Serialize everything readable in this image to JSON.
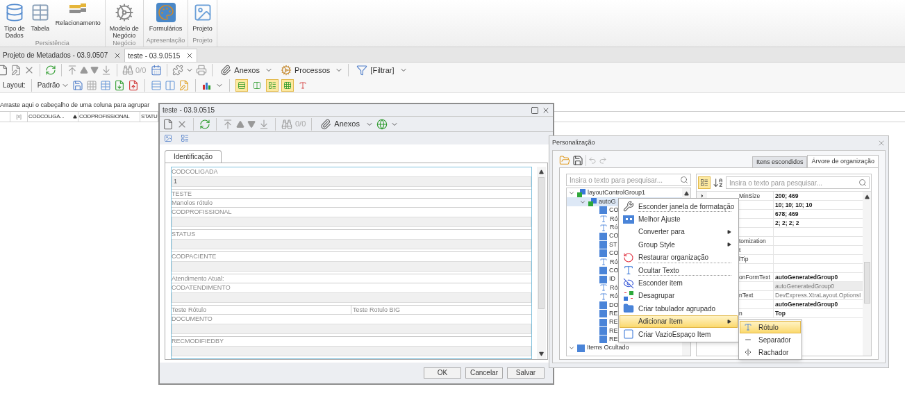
{
  "ribbon": {
    "groups": [
      {
        "label": "Persistência",
        "items": [
          {
            "label": "Tipo de\nDados"
          },
          {
            "label": "Tabela"
          },
          {
            "label": "Relacionamento"
          }
        ]
      },
      {
        "label": "Negócio",
        "items": [
          {
            "label": "Modelo de\nNegócio"
          }
        ]
      },
      {
        "label": "Apresentação",
        "items": [
          {
            "label": "Formulários"
          }
        ]
      },
      {
        "label": "Projeto",
        "items": [
          {
            "label": "Projeto"
          }
        ]
      }
    ]
  },
  "doc_tabs": [
    {
      "label": "Projeto de Metadados - 03.9.0507",
      "selected": false
    },
    {
      "label": "teste - 03.9.0515",
      "selected": true
    }
  ],
  "toolbar": {
    "counter": "0/0",
    "attachments": "Anexos",
    "processes": "Processos",
    "filter": "[Filtrar]"
  },
  "layout_bar": {
    "label": "Layout:",
    "preset": "Padrão",
    "toggles": [
      {
        "selected": true
      },
      {
        "selected": false
      },
      {
        "selected": true
      },
      {
        "selected": true
      },
      {
        "selected": false
      }
    ]
  },
  "group_panel": "Arraste aqui o cabeçalho de uma coluna para agrupar",
  "grid_columns": [
    "[x]",
    "CODCOLIGA...",
    "CODPROFISSIONAL",
    "STATU"
  ],
  "dialog": {
    "title": "teste - 03.9.0515",
    "counter": "0/0",
    "attachments": "Anexos",
    "tabs": [
      {
        "label": "Identificação",
        "selected": true
      }
    ],
    "form": [
      {
        "kind": "field",
        "label": "CODCOLIGADA",
        "value": "1"
      },
      {
        "kind": "label",
        "label": "TESTE"
      },
      {
        "kind": "label",
        "label": "Manolos rótulo"
      },
      {
        "kind": "field",
        "label": "CODPROFISSIONAL"
      },
      {
        "kind": "field",
        "label": "STATUS"
      },
      {
        "kind": "field",
        "label": "CODPACIENTE"
      },
      {
        "kind": "label",
        "label": "Atendimento Atual:"
      },
      {
        "kind": "field",
        "label": "CODATENDIMENTO"
      },
      {
        "kind": "pair",
        "label": "Teste Rótulo",
        "label_2": "Teste Rotulo BIG"
      },
      {
        "kind": "field",
        "label": "DOCUMENTO"
      },
      {
        "kind": "field",
        "label": "RECMODIFIEDBY"
      }
    ],
    "buttons": [
      "OK",
      "Cancelar",
      "Salvar"
    ]
  },
  "customization": {
    "title": "Personalização",
    "tabs": [
      {
        "label": "Itens escondidos",
        "selected": false
      },
      {
        "label": "Árvore de organização",
        "selected": true
      }
    ],
    "tree_search": {
      "placeholder": "Insira o texto para pesquisar..."
    },
    "tree": [
      {
        "label": "layoutControlGroup1",
        "kind": "group",
        "expanded": true,
        "children": [
          {
            "label": "autoG",
            "kind": "group",
            "expanded": true,
            "selected": true,
            "children": [
              {
                "label": "CO",
                "kind": "field"
              },
              {
                "label": "Ró",
                "kind": "label"
              },
              {
                "label": "Ró",
                "kind": "label"
              },
              {
                "label": "CO",
                "kind": "field"
              },
              {
                "label": "ST",
                "kind": "field"
              },
              {
                "label": "CO",
                "kind": "field"
              },
              {
                "label": "Ró",
                "kind": "label"
              },
              {
                "label": "CO",
                "kind": "field"
              },
              {
                "label": "ID",
                "kind": "field"
              },
              {
                "label": "Ró",
                "kind": "label"
              },
              {
                "label": "Ró",
                "kind": "label"
              },
              {
                "label": "DO",
                "kind": "field"
              },
              {
                "label": "RE",
                "kind": "field"
              },
              {
                "label": "RE",
                "kind": "field"
              },
              {
                "label": "RE",
                "kind": "field"
              },
              {
                "label": "RE",
                "kind": "field"
              }
            ]
          }
        ]
      },
      {
        "label": "Items Ocultado",
        "kind": "field",
        "expanded": true
      }
    ],
    "property_search": {
      "placeholder": "Insira o texto para pesquisar..."
    },
    "properties": [
      {
        "name": "MinSize",
        "value": "200; 469",
        "bold": true,
        "expandable": true,
        "selected": false
      },
      {
        "value": "10; 10; 10; 10",
        "bold": true,
        "selected": false
      },
      {
        "value": "678; 469",
        "bold": true,
        "selected": false
      },
      {
        "value": "2; 2; 2; 2",
        "bold": true,
        "selected": false
      },
      {
        "selected": false
      },
      {
        "name": "tomization",
        "selected": false
      },
      {
        "name": "t",
        "selected": false
      },
      {
        "name": "lTip",
        "selected": false
      },
      {
        "selected": false
      },
      {
        "name": "onFormText",
        "value": "autoGeneratedGroup0",
        "bold": true,
        "selected": false
      },
      {
        "value": "autoGeneratedGroup0",
        "bold": false,
        "selected": true
      },
      {
        "name": "nText",
        "value": "DevExpress.XtraLayout.OptionsI",
        "bold": false,
        "selected": false
      },
      {
        "value": "autoGeneratedGroup0",
        "bold": true,
        "selected": false
      },
      {
        "name": "n",
        "value": "Top",
        "bold": true,
        "selected": false
      }
    ]
  },
  "context_menu": {
    "items": [
      {
        "label": "Esconder janela de formatação",
        "submenu": false,
        "selected": false,
        "separator_after": true
      },
      {
        "label": "Melhor Ajuste",
        "submenu": false,
        "selected": false,
        "separator_after": false
      },
      {
        "label": "Converter para",
        "submenu": true,
        "selected": false,
        "separator_after": false
      },
      {
        "label": "Group Style",
        "submenu": true,
        "selected": false,
        "separator_after": false
      },
      {
        "label": "Restaurar organização",
        "submenu": false,
        "selected": false,
        "separator_after": true
      },
      {
        "label": "Ocultar Texto",
        "submenu": false,
        "selected": false,
        "separator_after": true
      },
      {
        "label": "Esconder item",
        "submenu": false,
        "selected": false,
        "separator_after": false
      },
      {
        "label": "Desagrupar",
        "submenu": false,
        "selected": false,
        "separator_after": false
      },
      {
        "label": "Criar tabulador agrupado",
        "submenu": false,
        "selected": false,
        "separator_after": false
      },
      {
        "label": "Adicionar Item",
        "submenu": true,
        "selected": true,
        "separator_after": false
      },
      {
        "label": "Criar VazioEspaço Item",
        "submenu": false,
        "selected": false,
        "separator_after": false
      }
    ],
    "submenu": [
      {
        "label": "Rótulo",
        "selected": true
      },
      {
        "label": "Separador",
        "selected": false
      },
      {
        "label": "Rachador",
        "selected": false
      }
    ]
  }
}
